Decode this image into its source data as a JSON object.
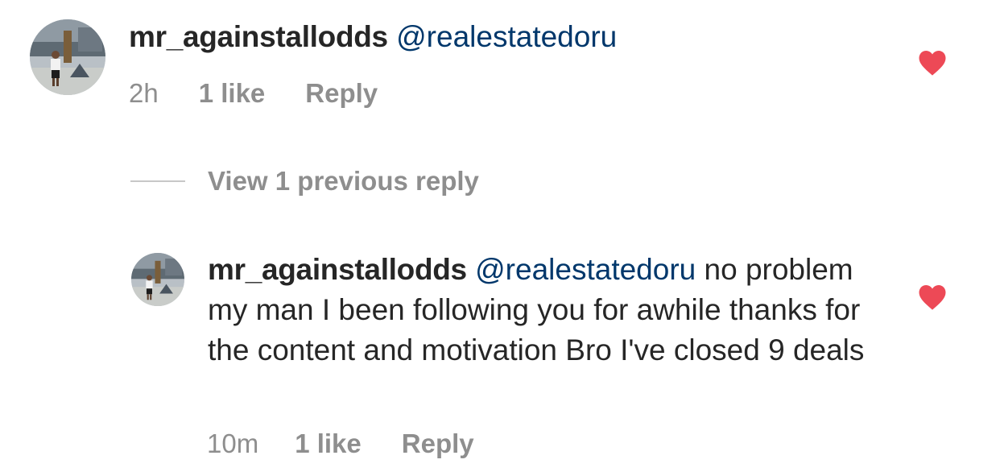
{
  "comments": [
    {
      "username": "mr_againstallodds",
      "mention": "@realestatedoru",
      "text": "",
      "time": "2h",
      "likes": "1 like",
      "reply_label": "Reply",
      "liked": true,
      "heart_color": "#ed4956"
    },
    {
      "username": "mr_againstallodds",
      "mention": "@realestatedoru",
      "text": "no problem my man I been following you for awhile thanks for the content and motivation Bro I've closed 9 deals",
      "time": "10m",
      "likes": "1 like",
      "reply_label": "Reply",
      "liked": true,
      "heart_color": "#ed4956"
    }
  ],
  "view_replies": {
    "label": "View 1 previous reply"
  },
  "colors": {
    "text": "#262626",
    "mention": "#00376b",
    "meta": "#8e8e8e",
    "divider": "#c7c7c7",
    "heart": "#ed4956"
  },
  "icons": {
    "like": "heart-icon-filled",
    "avatar": "profile-photo"
  }
}
